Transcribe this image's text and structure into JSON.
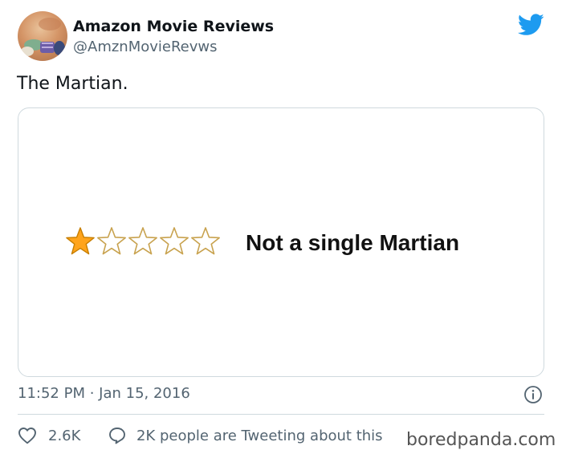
{
  "author": {
    "display_name": "Amazon Movie Reviews",
    "handle": "@AmznMovieRevws"
  },
  "logo": "twitter-bird-icon",
  "tweet": {
    "text": "The Martian."
  },
  "media": {
    "rating": 1,
    "rating_max": 5,
    "review_title": "Not a single Martian"
  },
  "meta": {
    "timestamp": "11:52 PM · Jan 15, 2016"
  },
  "actions": {
    "like_count": "2.6K",
    "conversation_text": "2K people are Tweeting about this"
  },
  "watermark": "boredpanda.com",
  "colors": {
    "twitter_blue": "#1d9bf0",
    "star_fill": "#ffa41c",
    "star_outline": "#c8a24e",
    "secondary_text": "#536471"
  }
}
